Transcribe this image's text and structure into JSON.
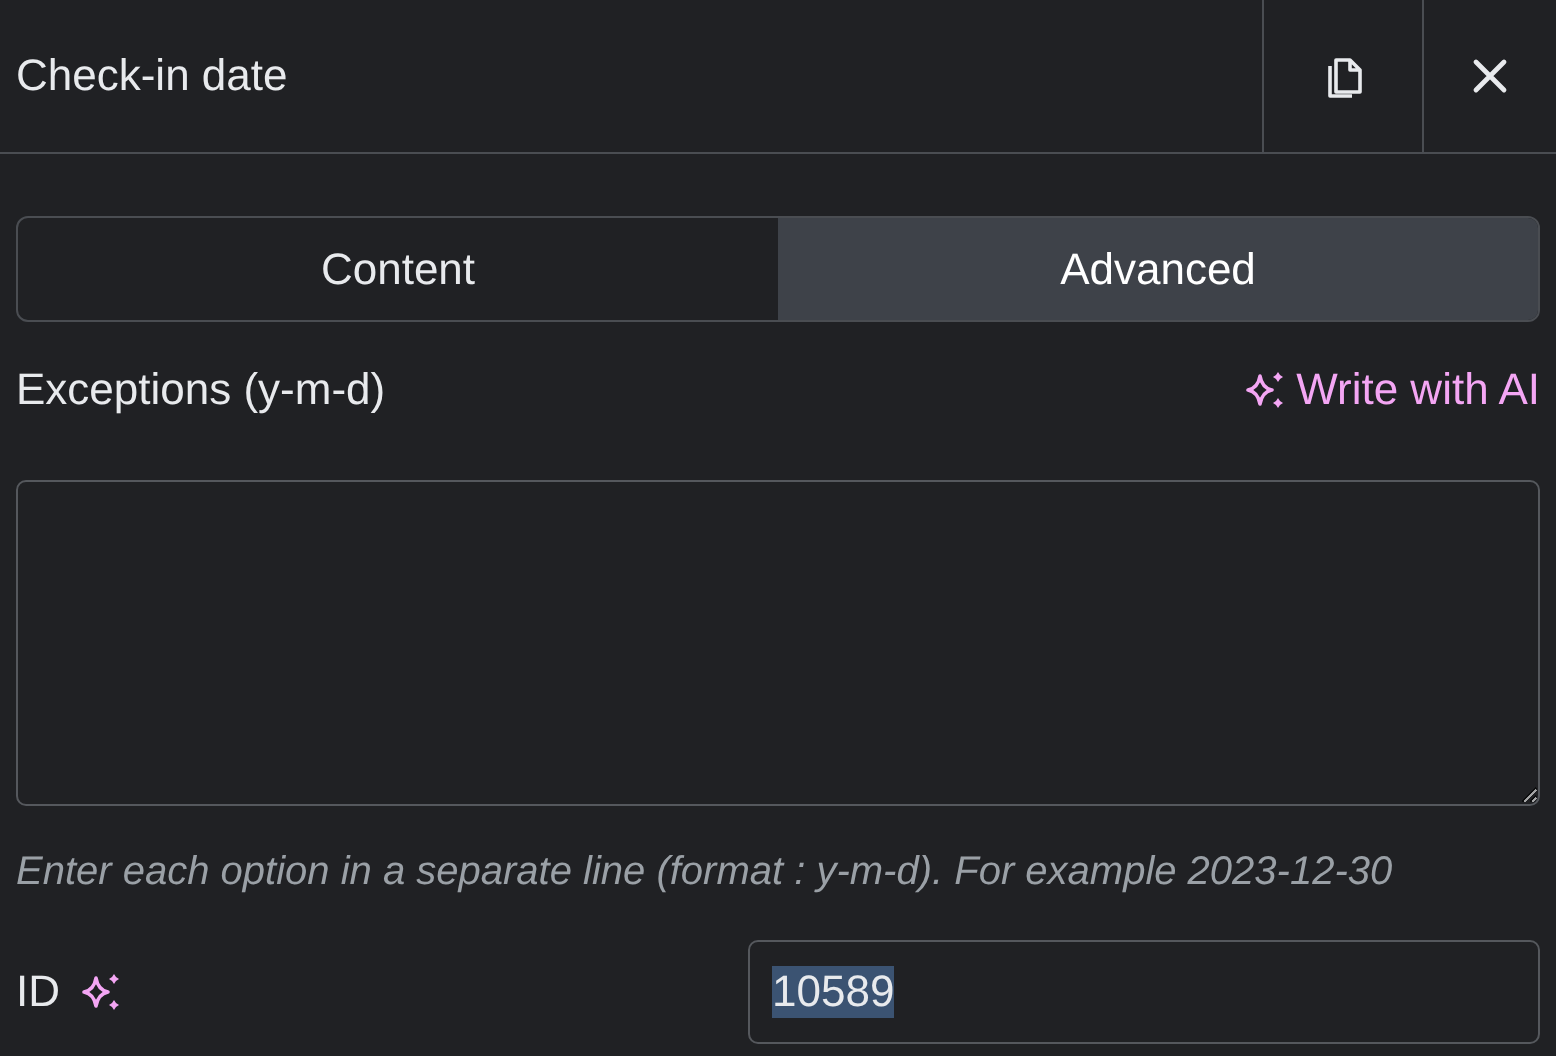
{
  "panel": {
    "title": "Check-in date"
  },
  "tabs": [
    {
      "label": "Content",
      "selected": false
    },
    {
      "label": "Advanced",
      "selected": true
    }
  ],
  "exceptions": {
    "label": "Exceptions (y-m-d)",
    "ai_link": "Write with AI",
    "hint": "Enter each option in a separate line (format : y-m-d). For example 2023-12-30"
  },
  "id_field": {
    "label": "ID",
    "value": "10589",
    "value_selected": true
  }
}
